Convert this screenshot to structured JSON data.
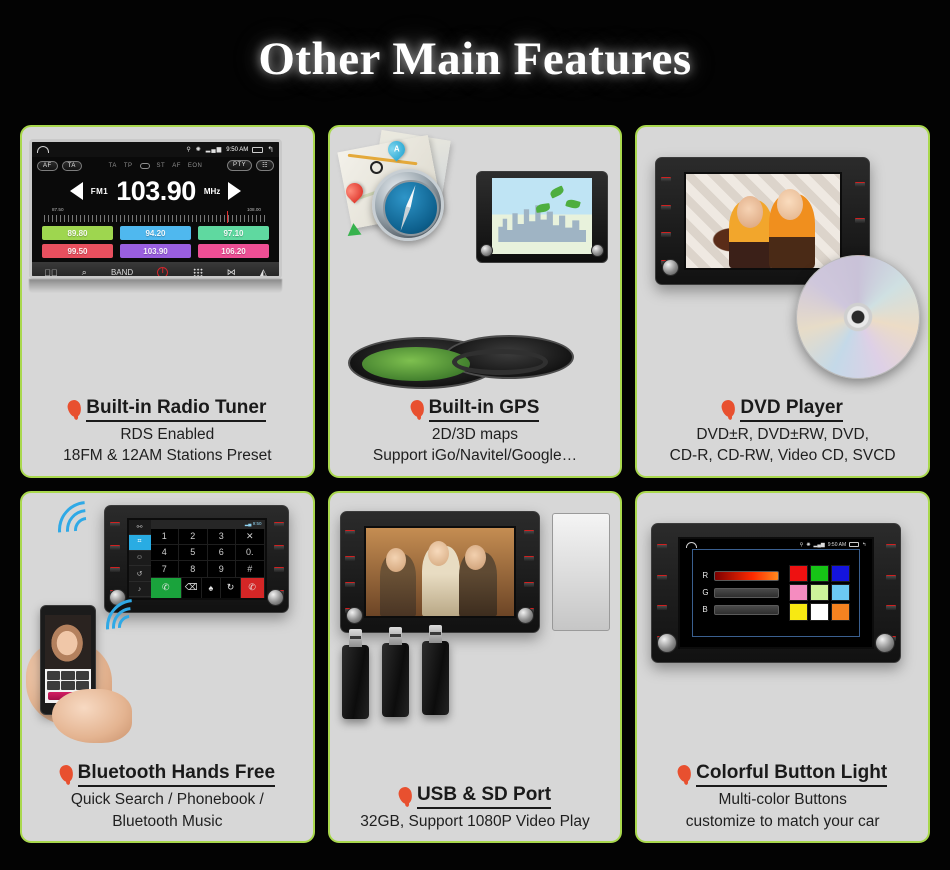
{
  "page": {
    "title": "Other Main Features",
    "background_color": "#030303",
    "card_background": "#d7d7d7",
    "card_border_color": "#a9d84d",
    "bullet_color": "#e8502f"
  },
  "cards": [
    {
      "id": "radio-tuner",
      "title": "Built-in Radio Tuner",
      "lines": [
        "RDS Enabled",
        "18FM & 12AM Stations Preset"
      ],
      "bullet": "balloon-marker-icon"
    },
    {
      "id": "gps",
      "title": "Built-in GPS",
      "lines": [
        "2D/3D maps",
        "Support iGo/Navitel/Google…"
      ],
      "bullet": "balloon-marker-icon"
    },
    {
      "id": "dvd-player",
      "title": "DVD Player",
      "lines": [
        "DVD±R, DVD±RW, DVD,",
        "CD-R, CD-RW, Video CD, SVCD"
      ],
      "bullet": "balloon-marker-icon"
    },
    {
      "id": "bluetooth",
      "title": "Bluetooth Hands Free",
      "lines": [
        "Quick Search / Phonebook /",
        "Bluetooth Music"
      ],
      "bullet": "balloon-marker-icon"
    },
    {
      "id": "usb-sd",
      "title": "USB & SD Port",
      "lines": [
        "32GB, Support 1080P Video Play",
        ""
      ],
      "bullet": "balloon-marker-icon"
    },
    {
      "id": "button-light",
      "title": "Colorful Button Light",
      "lines": [
        "Multi-color Buttons",
        "customize to match your car"
      ],
      "bullet": "balloon-marker-icon"
    }
  ],
  "radio_screen": {
    "status_time": "9:50 AM",
    "home_icon": "home-icon",
    "back_icon": "back-icon",
    "recents_icon": "recents-icon",
    "gps_icon": "gps-icon",
    "bluetooth_icon": "bluetooth-icon",
    "signal_icon": "signal-icon",
    "left_pills": [
      "AF",
      "TA"
    ],
    "right_pills": [
      "PTY",
      "EQ"
    ],
    "rds_flags": [
      "TA",
      "TP",
      "",
      "ST",
      "AF",
      "EON"
    ],
    "band": "FM1",
    "frequency": "103.90",
    "unit": "MHz",
    "prev_icon": "previous-arrow-icon",
    "next_icon": "next-arrow-icon",
    "scale_min": "87.50",
    "scale_max": "108.00",
    "presets": [
      {
        "value": "89.80",
        "color": "#9ed64f"
      },
      {
        "value": "94.20",
        "color": "#4fb8ef"
      },
      {
        "value": "97.10",
        "color": "#5fd9a0"
      },
      {
        "value": "99.50",
        "color": "#e8505f"
      },
      {
        "value": "103.90",
        "color": "#9a5fe0"
      },
      {
        "value": "106.20",
        "color": "#ee4f95"
      }
    ],
    "toolbar": [
      "mute-icon",
      "search-icon",
      "BAND",
      "power-icon",
      "keypad-icon",
      "scan-icon",
      "equalizer-icon"
    ]
  },
  "gps_art": {
    "map_pin_label": "A",
    "compass_icon": "compass-icon",
    "map_icon": "paper-map-icon",
    "unit_icon": "car-head-unit-icon"
  },
  "dvd_art": {
    "disc_icon": "dvd-disc-icon",
    "unit_icon": "car-head-unit-icon"
  },
  "bluetooth_screen": {
    "side_items": [
      "link-icon",
      "dialpad-icon",
      "contacts-icon",
      "history-icon",
      "music-icon"
    ],
    "keys": [
      "1",
      "2",
      "3",
      "✕",
      "4",
      "5",
      "6",
      "0.",
      "7",
      "8",
      "9",
      "#"
    ],
    "actions": [
      "call-icon",
      "keypad-icon",
      "mic-icon",
      "refresh-icon",
      "hangup-icon"
    ],
    "call_button_color": "#1aa33c",
    "end_button_color": "#d42626",
    "wave_icon": "bluetooth-wave-icon",
    "phone_icon": "smartphone-icon",
    "hand_icon": "hand-icon"
  },
  "usb_art": {
    "stick_icon": "usb-flash-drive-icon",
    "unit_icon": "car-head-unit-icon",
    "count": 3
  },
  "color_light_screen": {
    "status_time": "9:50 AM",
    "channels": [
      "R",
      "G",
      "B"
    ],
    "active_channel_gradient": "#ff2a00",
    "swatches": [
      "#ee1111",
      "#16c416",
      "#1414dd",
      "#f58cc0",
      "#cdf29a",
      "#6cc9f2",
      "#f7e912",
      "#ffffff",
      "#f58220"
    ]
  }
}
